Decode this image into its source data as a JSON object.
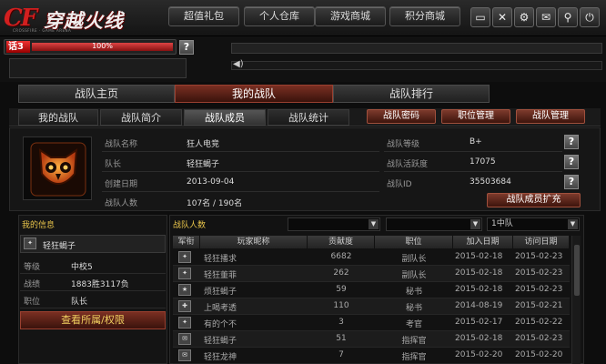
{
  "header": {
    "logo_cf": "CF",
    "logo_cn": "穿越火线",
    "logo_sub": "CROSSFIRE · GAME ARENA",
    "nav": [
      "超值礼包",
      "个人仓库",
      "游戏商城",
      "积分商城"
    ],
    "icons": [
      "minimize-icon",
      "close-x-icon",
      "network-icon",
      "mail-icon",
      "location-icon",
      "power-icon"
    ]
  },
  "status": {
    "level_label": "话3",
    "exp_text": "100%",
    "exp_fraction": 1.0,
    "help": "?"
  },
  "main_tabs": [
    {
      "label": "战队主页",
      "active": false
    },
    {
      "label": "我的战队",
      "active": true
    },
    {
      "label": "战队排行",
      "active": false
    }
  ],
  "sub_tabs": [
    {
      "label": "我的战队",
      "active": false
    },
    {
      "label": "战队简介",
      "active": false
    },
    {
      "label": "战队成员",
      "active": true
    },
    {
      "label": "战队统计",
      "active": false
    }
  ],
  "action_buttons": [
    "战队密码",
    "职位管理",
    "战队管理"
  ],
  "clan_info": {
    "name_label": "战队名称",
    "name": "狂人电竞",
    "leader_label": "队长",
    "leader": "轻狂蝎子",
    "created_label": "创建日期",
    "created": "2013-09-04",
    "members_label": "战队人数",
    "members": "107名 / 190名",
    "level_label": "战队等级",
    "level": "B+",
    "activity_label": "战队活跃度",
    "activity": "17075",
    "id_label": "战队ID",
    "id": "35503684",
    "expand_label": "战队成员扩充"
  },
  "my_info": {
    "title": "我的信息",
    "name": "轻狂蝎子",
    "rows": [
      {
        "k": "等级",
        "v": "中校5"
      },
      {
        "k": "战绩",
        "v": "1883胜3117负"
      },
      {
        "k": "职位",
        "v": "队长"
      }
    ],
    "view_button": "查看所属/权限"
  },
  "member_table": {
    "title": "战队人数",
    "filter_value": "",
    "squad_filter": "",
    "squad_value": "1中队",
    "columns": [
      "军衔",
      "玩家昵称",
      "贡献度",
      "职位",
      "加入日期",
      "访问日期"
    ],
    "rows": [
      [
        "轻狂播求",
        "6682",
        "副队长",
        "2015-02-18",
        "2015-02-23"
      ],
      [
        "轻狂董菲",
        "262",
        "副队长",
        "2015-02-18",
        "2015-02-23"
      ],
      [
        "烦狂蝎子",
        "59",
        "秘书",
        "2015-02-18",
        "2015-02-23"
      ],
      [
        "上喝考透",
        "110",
        "秘书",
        "2014-08-19",
        "2015-02-21"
      ],
      [
        "有的个不",
        "3",
        "考官",
        "2015-02-17",
        "2015-02-22"
      ],
      [
        "轻狂蝎子",
        "51",
        "指挥官",
        "2015-02-18",
        "2015-02-23"
      ],
      [
        "轻狂龙神",
        "7",
        "指挥官",
        "2015-02-20",
        "2015-02-20"
      ]
    ]
  }
}
